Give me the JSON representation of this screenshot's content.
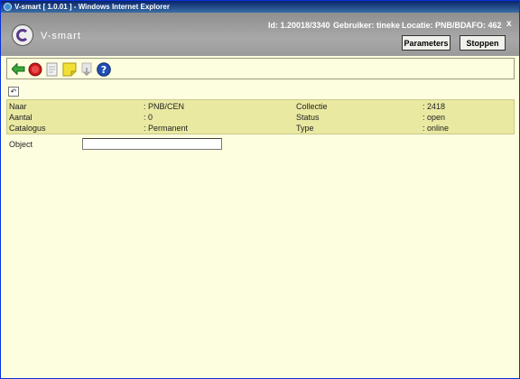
{
  "titlebar": {
    "title": "V-smart [ 1.0.01 ] - Windows Internet Explorer"
  },
  "header": {
    "brand": "V-smart",
    "id_text": "Id: 1.20018/3340",
    "user_text": "Gebruiker: tineke",
    "location_text": "Locatie: PNB/BD",
    "afo_text": "AFO: 462",
    "close_label": "x",
    "parameters_label": "Parameters",
    "stop_label": "Stoppen"
  },
  "toolbar": {
    "icons": [
      "back-arrow-icon",
      "stop-circle-icon",
      "document-icon",
      "note-icon",
      "download-icon",
      "help-icon"
    ],
    "colors": {
      "back": "#3aa63a",
      "stop": "#cc1a1a",
      "note": "#f2e035",
      "help": "#1f4fb5"
    }
  },
  "undo_symbol": "↶",
  "info": {
    "rows": [
      {
        "label1": "Naar",
        "value1": ": PNB/CEN",
        "label2": "Collectie",
        "value2": ": 2418"
      },
      {
        "label1": "Aantal",
        "value1": ": 0",
        "label2": "Status",
        "value2": ": open"
      },
      {
        "label1": "Catalogus",
        "value1": ": Permanent",
        "label2": "Type",
        "value2": ": online"
      }
    ]
  },
  "form": {
    "object_label": "Object",
    "object_value": ""
  }
}
